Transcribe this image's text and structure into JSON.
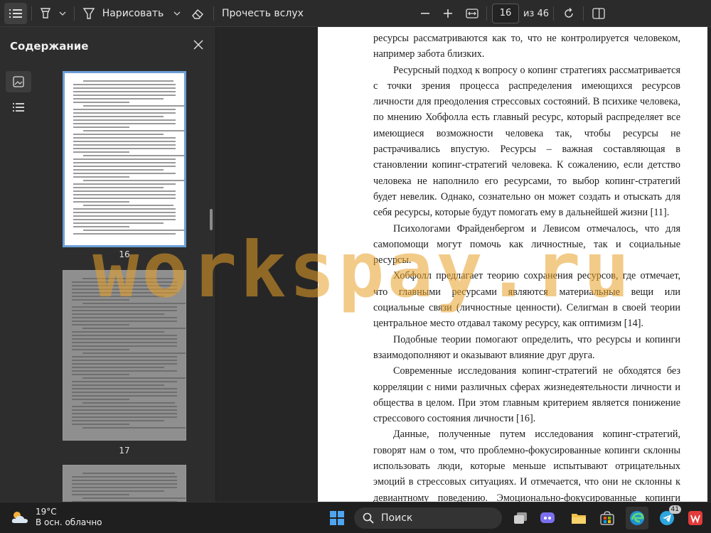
{
  "toolbar": {
    "draw_label": "Нарисовать",
    "read_aloud_label": "Прочесть вслух",
    "page_current": "16",
    "page_total": "из 46"
  },
  "sidebar": {
    "title": "Содержание",
    "thumbnails": [
      {
        "page": "16",
        "current": true
      },
      {
        "page": "17",
        "current": false
      }
    ]
  },
  "document": {
    "paragraphs": [
      {
        "indent": false,
        "text": "ресурсы рассматриваются как то, что не контролируется человеком, например забота близких."
      },
      {
        "indent": true,
        "text": "Ресурсный подход к вопросу о копинг стратегиях рассматривается с точки зрения процесса распределения имеющихся ресурсов личности для преодоления стрессовых состояний. В психике человека, по мнению Хобфолла есть главный ресурс, который распределяет все имеющиеся возможности человека так, чтобы ресурсы не растрачивались впустую. Ресурсы – важная составляющая в становлении копинг-стратегий человека. К сожалению, если детство человека не наполнило его ресурсами, то выбор копинг-стратегий будет невелик. Однако, сознательно он может создать и отыскать для себя ресурсы, которые будут помогать ему в дальнейшей жизни [11]."
      },
      {
        "indent": true,
        "text": "Психологами Фрайденбергом и Левисом отмечалось, что для самопомощи могут помочь как личностные, так и социальные ресурсы."
      },
      {
        "indent": true,
        "text": "Хобфолл предлагает теорию сохранения ресурсов, где отмечает, что главными ресурсами являются материальные вещи или социальные связи (личностные ценности). Селигман в своей теории центральное место отдавал такому ресурсу, как оптимизм [14]."
      },
      {
        "indent": true,
        "text": "Подобные теории помогают определить, что ресурсы и копинги взаимодополняют и оказывают влияние друг друга."
      },
      {
        "indent": true,
        "text": "Современные исследования копинг-стратегий не обходятся без корреляции с ними различных сферах жизнедеятельности личности и общества в целом. При этом главным критерием является понижение стрессового состояния личности [16]."
      },
      {
        "indent": true,
        "text": "Данные, полученные путем исследования копинг-стратегий, говорят нам о том, что проблемно-фокусированные копинги склонны использовать люди, которые меньше испытывают отрицательных эмоций в стрессовых ситуациях. И отмечается, что они не склонны к девиантному поведению. Эмоционально-фокусированные копинги используют люди с девиантным поведениям и склонные к тревожным расстройствам личности."
      }
    ]
  },
  "watermark": "workspay.ru",
  "taskbar": {
    "temperature": "19°C",
    "weather_desc": "В осн. облачно",
    "search_label": "Поиск",
    "telegram_badge": "41"
  }
}
